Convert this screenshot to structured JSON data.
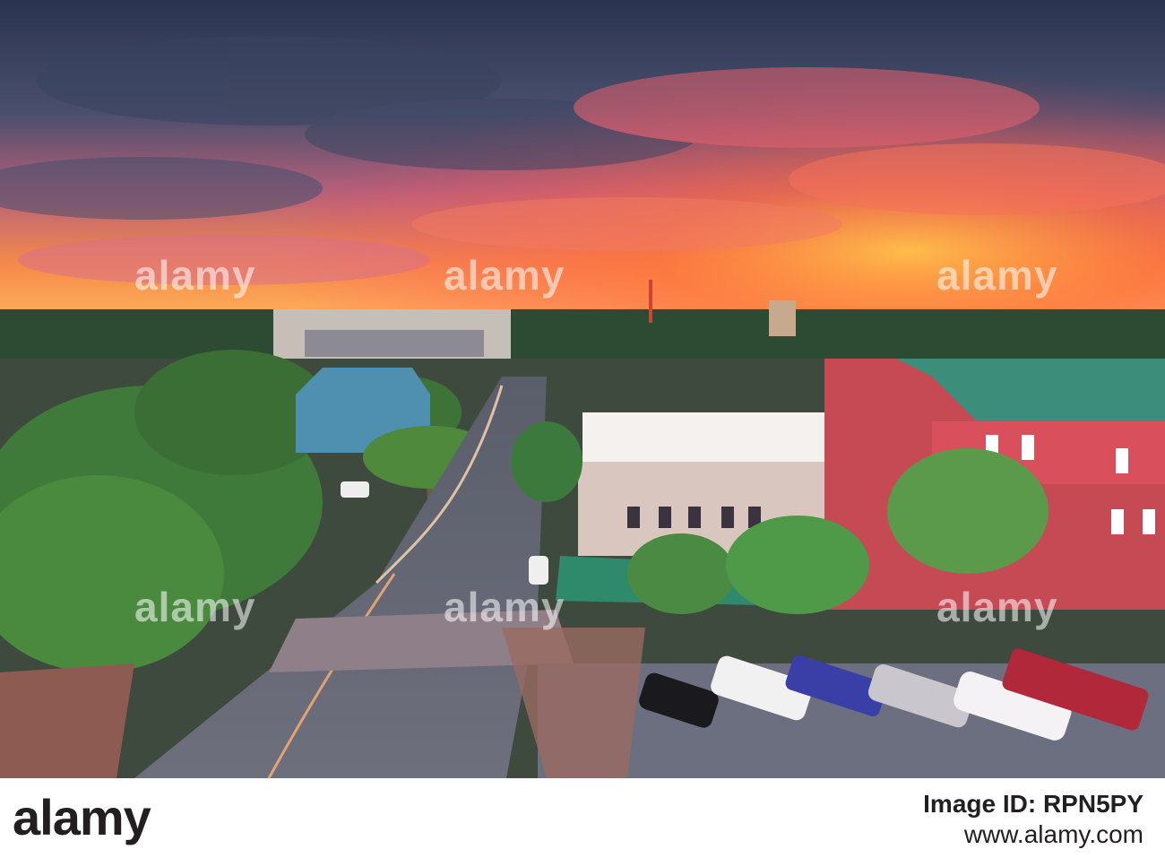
{
  "watermark": "alamy",
  "footer": {
    "logo": "alamy",
    "image_id": "Image ID: RPN5PY",
    "url": "www.alamy.com"
  },
  "colors": {
    "sky_top": "#2e3a55",
    "sunset_orange": "#ff7a2a",
    "sunset_pink": "#f3586a",
    "footer_bg": "#ffffff",
    "footer_text": "#231f20"
  }
}
